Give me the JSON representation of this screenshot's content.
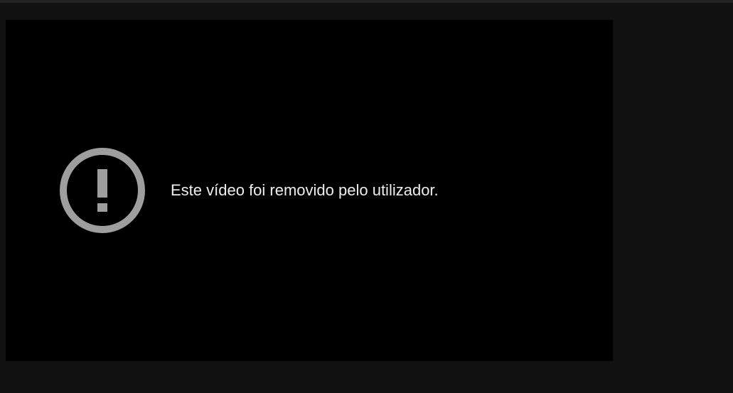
{
  "player": {
    "error_icon": "exclamation-circle-icon",
    "error_message": "Este vídeo foi removido pelo utilizador."
  },
  "colors": {
    "page_background": "#111111",
    "player_background": "#000000",
    "icon_color": "#9e9e9e",
    "message_color": "#eeeeee"
  }
}
